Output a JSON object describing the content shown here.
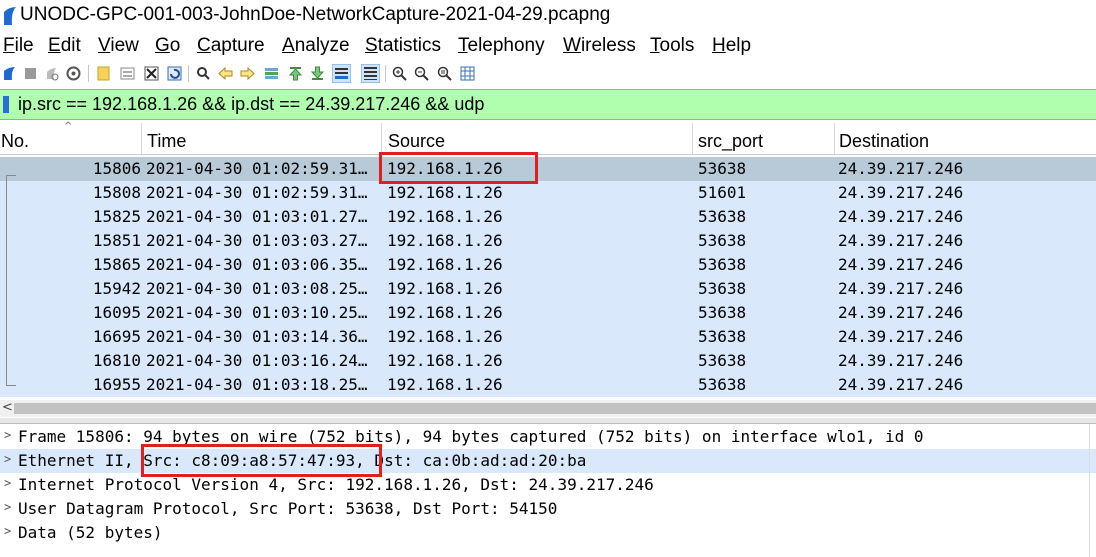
{
  "window": {
    "title": "UNODC-GPC-001-003-JohnDoe-NetworkCapture-2021-04-29.pcapng",
    "app_icon": "wireshark-fin-icon"
  },
  "menu": {
    "items": [
      "File",
      "Edit",
      "View",
      "Go",
      "Capture",
      "Analyze",
      "Statistics",
      "Telephony",
      "Wireless",
      "Tools",
      "Help"
    ]
  },
  "toolbar": {
    "icons": [
      "start-capture-icon",
      "stop-capture-icon",
      "restart-capture-icon",
      "capture-options-icon",
      "open-file-icon",
      "save-file-icon",
      "close-file-icon",
      "reload-file-icon",
      "find-packet-icon",
      "go-back-icon",
      "go-forward-icon",
      "go-to-packet-icon",
      "go-first-icon",
      "go-last-icon",
      "auto-scroll-icon",
      "colorize-icon",
      "zoom-in-icon",
      "zoom-out-icon",
      "zoom-normal-icon",
      "resize-columns-icon"
    ]
  },
  "filter": {
    "text": "ip.src == 192.168.1.26 && ip.dst == 24.39.217.246 && udp",
    "bg_color": "#afffaf"
  },
  "packet_list": {
    "columns": [
      "No.",
      "Time",
      "Source",
      "src_port",
      "Destination"
    ],
    "rows": [
      {
        "no": "15806",
        "time": "2021-04-30 01:02:59.31…",
        "source": "192.168.1.26",
        "src_port": "53638",
        "destination": "24.39.217.246"
      },
      {
        "no": "15808",
        "time": "2021-04-30 01:02:59.31…",
        "source": "192.168.1.26",
        "src_port": "51601",
        "destination": "24.39.217.246"
      },
      {
        "no": "15825",
        "time": "2021-04-30 01:03:01.27…",
        "source": "192.168.1.26",
        "src_port": "53638",
        "destination": "24.39.217.246"
      },
      {
        "no": "15851",
        "time": "2021-04-30 01:03:03.27…",
        "source": "192.168.1.26",
        "src_port": "53638",
        "destination": "24.39.217.246"
      },
      {
        "no": "15865",
        "time": "2021-04-30 01:03:06.35…",
        "source": "192.168.1.26",
        "src_port": "53638",
        "destination": "24.39.217.246"
      },
      {
        "no": "15942",
        "time": "2021-04-30 01:03:08.25…",
        "source": "192.168.1.26",
        "src_port": "53638",
        "destination": "24.39.217.246"
      },
      {
        "no": "16095",
        "time": "2021-04-30 01:03:10.25…",
        "source": "192.168.1.26",
        "src_port": "53638",
        "destination": "24.39.217.246"
      },
      {
        "no": "16695",
        "time": "2021-04-30 01:03:14.36…",
        "source": "192.168.1.26",
        "src_port": "53638",
        "destination": "24.39.217.246"
      },
      {
        "no": "16810",
        "time": "2021-04-30 01:03:16.24…",
        "source": "192.168.1.26",
        "src_port": "53638",
        "destination": "24.39.217.246"
      },
      {
        "no": "16955",
        "time": "2021-04-30 01:03:18.25…",
        "source": "192.168.1.26",
        "src_port": "53638",
        "destination": "24.39.217.246"
      }
    ],
    "row_color": "#dae8fc",
    "selected_color": "#b8c9d8"
  },
  "details": {
    "rows": [
      "Frame 15806: 94 bytes on wire (752 bits), 94 bytes captured (752 bits) on interface wlo1, id 0",
      "Ethernet II, Src: c8:09:a8:57:47:93, Dst: ca:0b:ad:ad:20:ba",
      "Internet Protocol Version 4, Src: 192.168.1.26, Dst: 24.39.217.246",
      "User Datagram Protocol, Src Port: 53638, Dst Port: 54150",
      "Data (52 bytes)"
    ],
    "ethernet_prefix": "Ethernet II, ",
    "ethernet_src": "Src: c8:09:a8:57:47:93,",
    "ethernet_dst": " Dst: ca:0b:ad:ad:20:ba"
  },
  "annotation_color": "#e02020"
}
